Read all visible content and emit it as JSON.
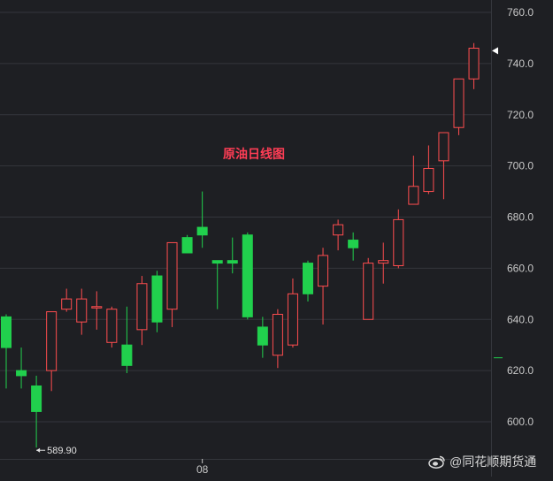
{
  "chart_data": {
    "type": "candlestick",
    "title": "原油日线图",
    "y_range": [
      580,
      770
    ],
    "y_ticks": [
      {
        "value": 760,
        "label": "760.0"
      },
      {
        "value": 740,
        "label": "740.0"
      },
      {
        "value": 720,
        "label": "720.0"
      },
      {
        "value": 700,
        "label": "700.0"
      },
      {
        "value": 680,
        "label": "680.0"
      },
      {
        "value": 660,
        "label": "660.0"
      },
      {
        "value": 640,
        "label": "640.0"
      },
      {
        "value": 620,
        "label": "620.0"
      },
      {
        "value": 600,
        "label": "600.0"
      }
    ],
    "x_tick": {
      "label": "08",
      "at_index": 13
    },
    "low_annotation": {
      "text": "589.90",
      "value": 589.9,
      "at_index": 2
    },
    "last_price_marker": 745,
    "candles": [
      {
        "open": 641,
        "high": 642,
        "low": 613,
        "close": 629
      },
      {
        "open": 620,
        "high": 629,
        "low": 613,
        "close": 618
      },
      {
        "open": 614,
        "high": 618,
        "low": 589.9,
        "close": 604
      },
      {
        "open": 620,
        "high": 643,
        "low": 612,
        "close": 643
      },
      {
        "open": 644,
        "high": 652,
        "low": 643,
        "close": 648
      },
      {
        "open": 639,
        "high": 652,
        "low": 634,
        "close": 648
      },
      {
        "open": 645,
        "high": 651,
        "low": 636,
        "close": 645
      },
      {
        "open": 631,
        "high": 645,
        "low": 629,
        "close": 644
      },
      {
        "open": 630,
        "high": 645,
        "low": 619,
        "close": 622
      },
      {
        "open": 636,
        "high": 657,
        "low": 630,
        "close": 654
      },
      {
        "open": 657,
        "high": 659,
        "low": 635,
        "close": 639
      },
      {
        "open": 644,
        "high": 670,
        "low": 637,
        "close": 670
      },
      {
        "open": 672,
        "high": 673,
        "low": 666,
        "close": 666
      },
      {
        "open": 676,
        "high": 690,
        "low": 668,
        "close": 673
      },
      {
        "open": 663,
        "high": 663,
        "low": 644,
        "close": 662
      },
      {
        "open": 663,
        "high": 672,
        "low": 658,
        "close": 662
      },
      {
        "open": 673,
        "high": 674,
        "low": 640,
        "close": 641
      },
      {
        "open": 637,
        "high": 641,
        "low": 625,
        "close": 630
      },
      {
        "open": 626,
        "high": 644,
        "low": 621,
        "close": 642
      },
      {
        "open": 630,
        "high": 656,
        "low": 629,
        "close": 650
      },
      {
        "open": 662,
        "high": 663,
        "low": 647,
        "close": 650
      },
      {
        "open": 653,
        "high": 668,
        "low": 638,
        "close": 665
      },
      {
        "open": 673,
        "high": 679,
        "low": 667,
        "close": 677
      },
      {
        "open": 671,
        "high": 674,
        "low": 663,
        "close": 668
      },
      {
        "open": 640,
        "high": 664,
        "low": 640,
        "close": 662
      },
      {
        "open": 662,
        "high": 670,
        "low": 654,
        "close": 663
      },
      {
        "open": 661,
        "high": 683,
        "low": 660,
        "close": 679
      },
      {
        "open": 685,
        "high": 704,
        "low": 685,
        "close": 692
      },
      {
        "open": 690,
        "high": 708,
        "low": 689,
        "close": 699
      },
      {
        "open": 702,
        "high": 713,
        "low": 687,
        "close": 713
      },
      {
        "open": 715,
        "high": 734,
        "low": 712,
        "close": 734
      },
      {
        "open": 734,
        "high": 748,
        "low": 730,
        "close": 746
      }
    ],
    "colors": {
      "up": "#ff4d4f",
      "down": "#21d04d",
      "background": "#1e1f23",
      "grid": "#34363c",
      "axis_text": "#c8c8c8",
      "title": "#ff3d55"
    }
  },
  "watermark": {
    "icon": "weibo-icon",
    "text": "@同花顺期货通"
  }
}
